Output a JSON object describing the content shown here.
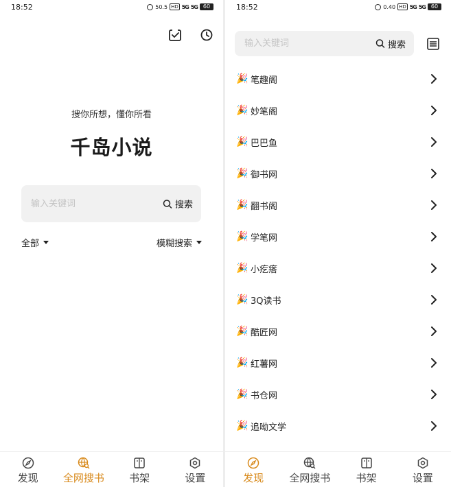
{
  "status_bar": {
    "time": "18:52",
    "net_speed_left": "50.5",
    "net_speed_right": "0.40",
    "hd": "HD",
    "signal1": "5G",
    "signal2": "5G",
    "battery": "60"
  },
  "left": {
    "slogan": "搜你所想，懂你所看",
    "title": "千岛小说",
    "search": {
      "placeholder": "输入关键词",
      "button": "搜索"
    },
    "filter_scope": "全部",
    "filter_mode": "模糊搜索"
  },
  "right": {
    "search": {
      "placeholder": "输入关键词",
      "button": "搜索"
    },
    "sources": [
      {
        "emoji": "🎉",
        "name": "笔趣阁"
      },
      {
        "emoji": "🎉",
        "name": "妙笔阁"
      },
      {
        "emoji": "🎉",
        "name": "巴巴鱼"
      },
      {
        "emoji": "🎉",
        "name": "御书网"
      },
      {
        "emoji": "🎉",
        "name": "翻书阁"
      },
      {
        "emoji": "🎉",
        "name": "学笔网"
      },
      {
        "emoji": "🎉",
        "name": "小疙瘩"
      },
      {
        "emoji": "🎉",
        "name": "3Q读书"
      },
      {
        "emoji": "🎉",
        "name": "酷匠网"
      },
      {
        "emoji": "🎉",
        "name": "红薯网"
      },
      {
        "emoji": "🎉",
        "name": "书仓网"
      },
      {
        "emoji": "🎉",
        "name": "追呦文学"
      }
    ]
  },
  "tabbar": {
    "tabs": [
      {
        "label": "发现",
        "icon": "compass-icon"
      },
      {
        "label": "全网搜书",
        "icon": "globe-search-icon"
      },
      {
        "label": "书架",
        "icon": "book-icon"
      },
      {
        "label": "设置",
        "icon": "gear-icon"
      }
    ],
    "active_color": "#d88a1c"
  }
}
